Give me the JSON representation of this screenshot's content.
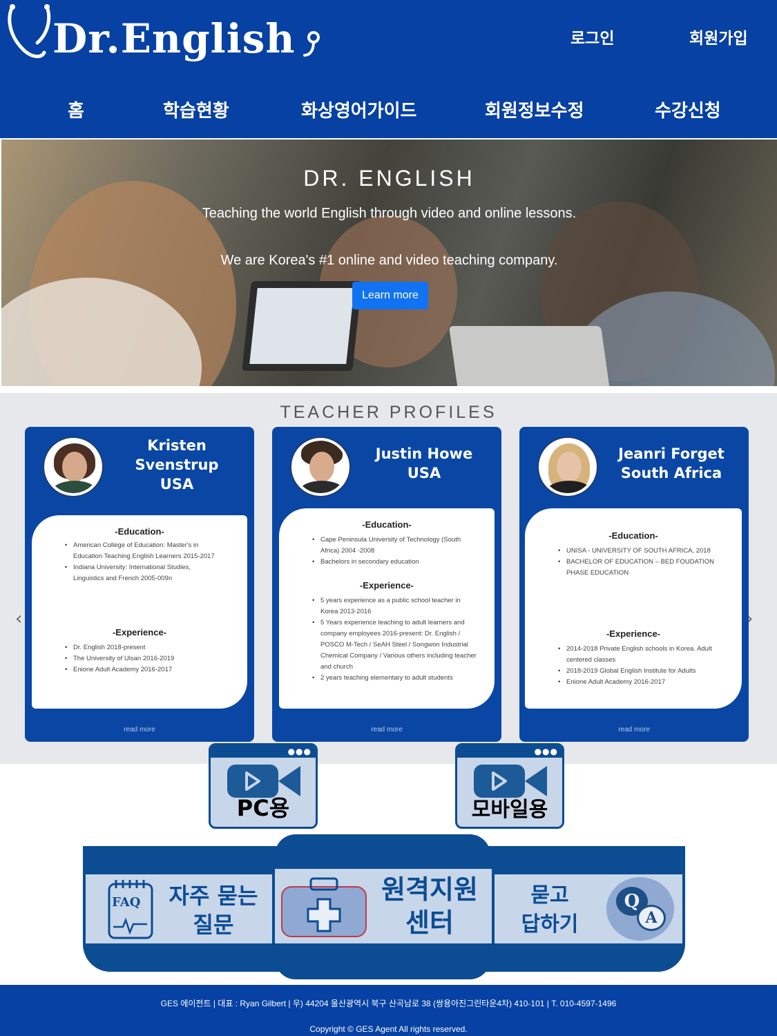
{
  "header": {
    "logo_text": "Dr.English",
    "login": "로그인",
    "signup": "회원가입",
    "nav": [
      "홈",
      "학습현황",
      "화상영어가이드",
      "회원정보수정",
      "수강신청"
    ]
  },
  "hero": {
    "title": "DR. ENGLISH",
    "line1": "Teaching the world English through video and online lessons.",
    "line2": "We are Korea's #1 online and video teaching company.",
    "button": "Learn more"
  },
  "profiles": {
    "title": "TEACHER PROFILES",
    "prev_icon": "chevron-left-icon",
    "next_icon": "chevron-right-icon",
    "teachers": [
      {
        "name_line1": "Kristen",
        "name_line2": "Svenstrup",
        "name_line3": "USA",
        "education_head": "-Education-",
        "education": [
          "American College of Education: Master's in Education Teaching English Learners 2015-2017",
          "Indiana University: International Studies, Linguistics and French 2005-009n"
        ],
        "experience_head": "-Experience-",
        "experience": [
          "Dr. English 2018-present",
          "The University of Ulsan 2016-2019",
          "Enione Adult Academy 2016-2017"
        ],
        "read_more": "read more"
      },
      {
        "name_line1": "Justin Howe",
        "name_line2": "USA",
        "education_head": "-Education-",
        "education": [
          "Cape Peninsula University of Technology (South Africa) 2004 -2008",
          "Bachelors in secondary education"
        ],
        "experience_head": "-Experience-",
        "experience": [
          "5 years experience as a public school teacher in Korea 2013-2016",
          "5 Years experience teaching to adult learners and company employees 2016-present: Dr. English / POSCO M-Tech / SeAH Steel / Songwon Industrial Chemical Company / Various others including teacher and church",
          "2 years teaching elementary to adult students"
        ],
        "read_more": "read more"
      },
      {
        "name_line1": "Jeanri Forget",
        "name_line2": "South Africa",
        "education_head": "-Education-",
        "education": [
          "UNISA - UNIVERSITY OF SOUTH AFRICA, 2018",
          "BACHELOR OF EDUCATION – BED FOUDATION PHASE EDUCATION"
        ],
        "experience_head": "-Experience-",
        "experience": [
          "2014-2018 Private English schools in Korea. Adult centered classes",
          "2018-2019 Global English Institute for Adults",
          "Enione Adult Academy 2016-2017"
        ],
        "read_more": "read more"
      }
    ]
  },
  "video_buttons": {
    "pc": "PC용",
    "mobile": "모바일용",
    "dots": "●●●"
  },
  "support": {
    "faq_badge": "FAQ",
    "faq_line1": "자주 묻는",
    "faq_line2": "질문",
    "remote_line1": "원격지원",
    "remote_line2": "센터",
    "qa_line1": "묻고",
    "qa_line2": "답하기",
    "qa_q": "Q",
    "qa_a": "A"
  },
  "footer": {
    "line1": "GES 에이전트 | 대표 : Ryan Gilbert | 우) 44204 울산광역시 북구 산곡남로 38 (쌍용아진그린타운4차) 410-101 | T. 010-4597-1496",
    "line2": "Copyright © GES Agent All rights reserved."
  },
  "colors": {
    "brand_blue": "#0641a3",
    "panel_blue": "#0c4c93",
    "tile_bg": "#c8d6ea",
    "hero_button": "#1273f2"
  }
}
